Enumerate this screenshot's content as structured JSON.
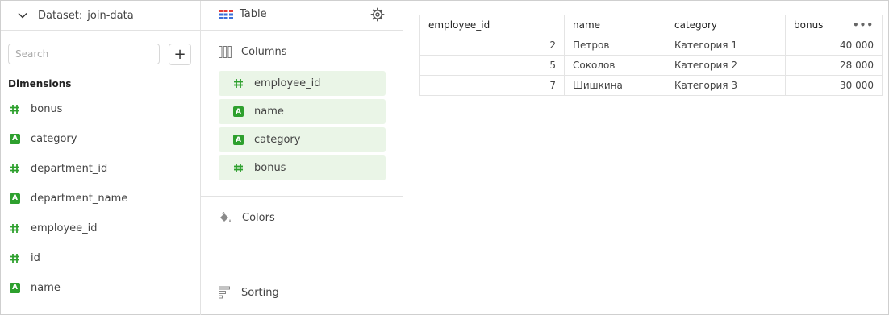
{
  "dataset": {
    "label": "Dataset:",
    "name": "join-data"
  },
  "search": {
    "placeholder": "Search",
    "add_label": "+"
  },
  "dimensions": {
    "title": "Dimensions",
    "items": [
      {
        "name": "bonus",
        "type": "number"
      },
      {
        "name": "category",
        "type": "string"
      },
      {
        "name": "department_id",
        "type": "number"
      },
      {
        "name": "department_name",
        "type": "string"
      },
      {
        "name": "employee_id",
        "type": "number"
      },
      {
        "name": "id",
        "type": "number"
      },
      {
        "name": "name",
        "type": "string"
      }
    ]
  },
  "visualization": {
    "label": "Table"
  },
  "columns_section": {
    "title": "Columns",
    "chips": [
      {
        "name": "employee_id",
        "type": "number"
      },
      {
        "name": "name",
        "type": "string"
      },
      {
        "name": "category",
        "type": "string"
      },
      {
        "name": "bonus",
        "type": "number"
      }
    ]
  },
  "colors_section": {
    "title": "Colors"
  },
  "sorting_section": {
    "title": "Sorting"
  },
  "table": {
    "headers": [
      "employee_id",
      "name",
      "category",
      "bonus"
    ],
    "more_label": "•••",
    "rows": [
      [
        "2",
        "Петров",
        "Категория 1",
        "40 000"
      ],
      [
        "5",
        "Соколов",
        "Категория 2",
        "28 000"
      ],
      [
        "7",
        "Шишкина",
        "Категория 3",
        "30 000"
      ]
    ]
  },
  "colors": {
    "accent_green": "#2ea02e",
    "chip_bg": "#eaf5e7",
    "table_icon": "#e53935"
  }
}
